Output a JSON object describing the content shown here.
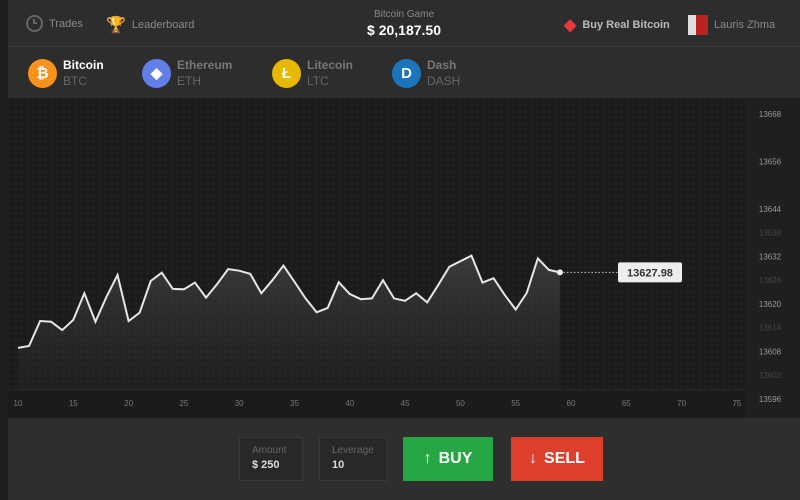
{
  "header": {
    "trades_label": "Trades",
    "leaderboard_label": "Leaderboard",
    "game_title": "Bitcoin Game",
    "balance": "$ 20,187.50",
    "buy_real_label": "Buy Real Bitcoin",
    "user_name": "Lauris Zhma"
  },
  "coins": [
    {
      "name": "Bitcoin",
      "symbol": "BTC",
      "glyph": "₿",
      "color": "#f7931a"
    },
    {
      "name": "Ethereum",
      "symbol": "ETH",
      "glyph": "◆",
      "color": "#627eea"
    },
    {
      "name": "Litecoin",
      "symbol": "LTC",
      "glyph": "Ł",
      "color": "#e6b800"
    },
    {
      "name": "Dash",
      "symbol": "DASH",
      "glyph": "D",
      "color": "#1c75bc"
    }
  ],
  "chart_data": {
    "type": "area",
    "x": [
      10,
      11,
      12,
      13,
      14,
      15,
      16,
      17,
      18,
      19,
      20,
      21,
      22,
      23,
      24,
      25,
      26,
      27,
      28,
      29,
      30,
      31,
      32,
      33,
      34,
      35,
      36,
      37,
      38,
      39,
      40,
      41,
      42,
      43,
      44,
      45,
      46,
      47,
      48,
      49,
      50,
      51,
      52,
      53,
      54,
      55,
      56,
      57,
      58,
      59
    ],
    "values": [
      13608.9,
      13609.4,
      13615.7,
      13615.5,
      13613.4,
      13616,
      13622.7,
      13615.5,
      13621.8,
      13627.3,
      13615.7,
      13617.8,
      13625.8,
      13627.9,
      13623.8,
      13623.7,
      13625.4,
      13621.6,
      13625,
      13628.8,
      13628.4,
      13627.6,
      13622.7,
      13626,
      13629.7,
      13625.6,
      13621.4,
      13617.9,
      13619,
      13625.5,
      13622.5,
      13621.2,
      13621.4,
      13626,
      13621.4,
      13620.8,
      13622.7,
      13620.4,
      13624.8,
      13629.4,
      13630.8,
      13632.2,
      13625.4,
      13626.5,
      13622.3,
      13618.6,
      13622.8,
      13631.5,
      13628.6,
      13627.98
    ],
    "current_label": "13627.98",
    "xticks": [
      10,
      15,
      20,
      25,
      30,
      35,
      40,
      45,
      50,
      55,
      60,
      65,
      70,
      75
    ],
    "yticks": [
      "13668",
      "13656",
      "13644",
      "13632",
      "13620",
      "13608",
      "13596"
    ],
    "yticks_minor": [
      "13638",
      "13626",
      "13614",
      "13602"
    ],
    "xlim": [
      10,
      76
    ],
    "ylim": [
      13596,
      13668
    ]
  },
  "controls": {
    "amount_label": "Amount",
    "amount_value": "$ 250",
    "leverage_label": "Leverage",
    "leverage_value": "10",
    "buy_label": "BUY",
    "sell_label": "SELL",
    "buy_color": "#27a644",
    "sell_color": "#dc3f2b"
  }
}
